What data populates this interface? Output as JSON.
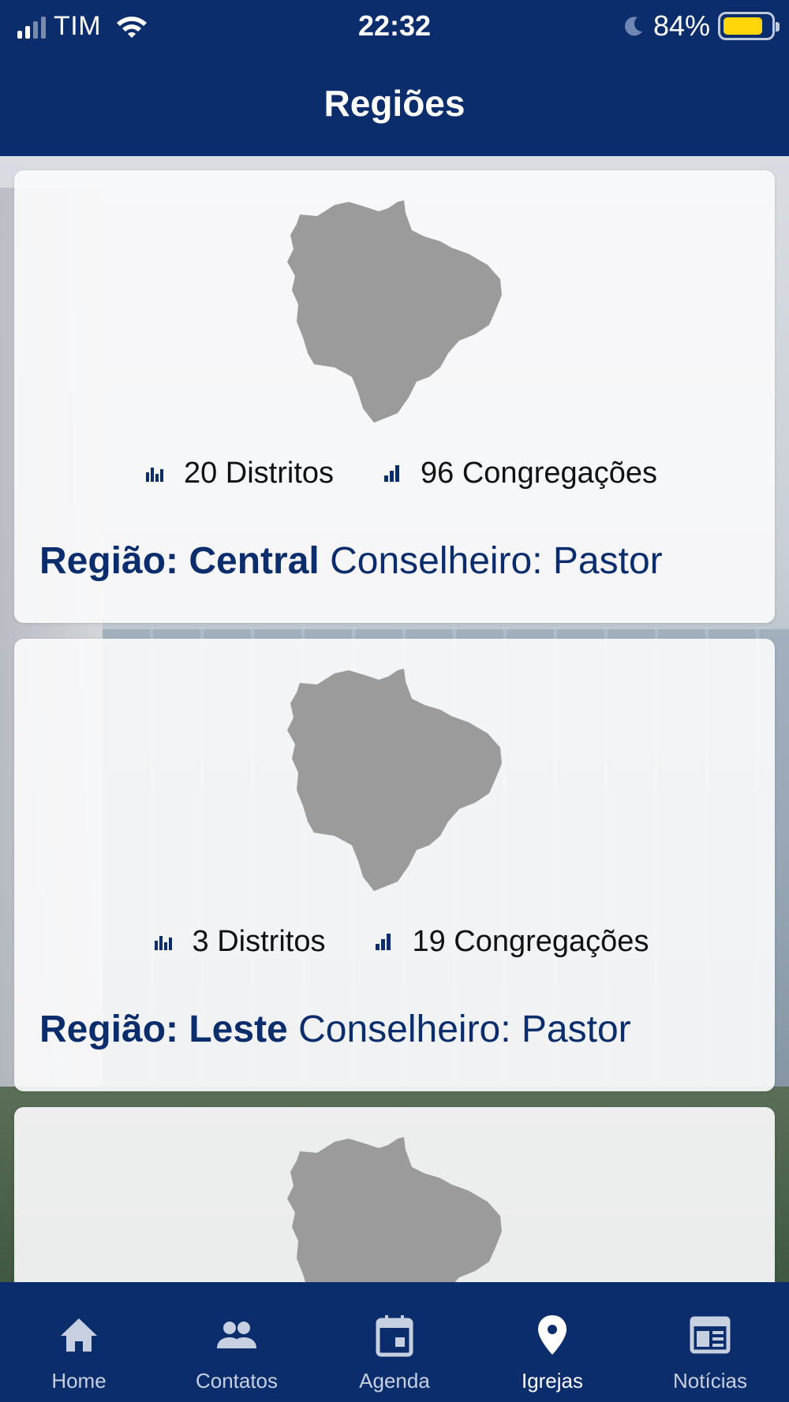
{
  "status_bar": {
    "carrier": "TIM",
    "time": "22:32",
    "battery": "84%",
    "battery_level": 0.84
  },
  "header": {
    "title": "Regiões"
  },
  "regions": [
    {
      "districts": "20 Distritos",
      "congregations": "96 Congregações",
      "label": "Região:",
      "name": "Central",
      "counselor": "Conselheiro: Pastor"
    },
    {
      "districts": "3 Distritos",
      "congregations": "19 Congregações",
      "label": "Região:",
      "name": "Leste",
      "counselor": "Conselheiro: Pastor"
    }
  ],
  "tabs": [
    {
      "label": "Home",
      "icon": "home-icon"
    },
    {
      "label": "Contatos",
      "icon": "people-icon"
    },
    {
      "label": "Agenda",
      "icon": "calendar-icon"
    },
    {
      "label": "Igrejas",
      "icon": "location-pin-icon",
      "active": true
    },
    {
      "label": "Notícias",
      "icon": "newspaper-icon"
    }
  ],
  "colors": {
    "primary": "#0b2d6b",
    "map_gray": "#9b9b9b",
    "battery": "#ffd60a"
  }
}
